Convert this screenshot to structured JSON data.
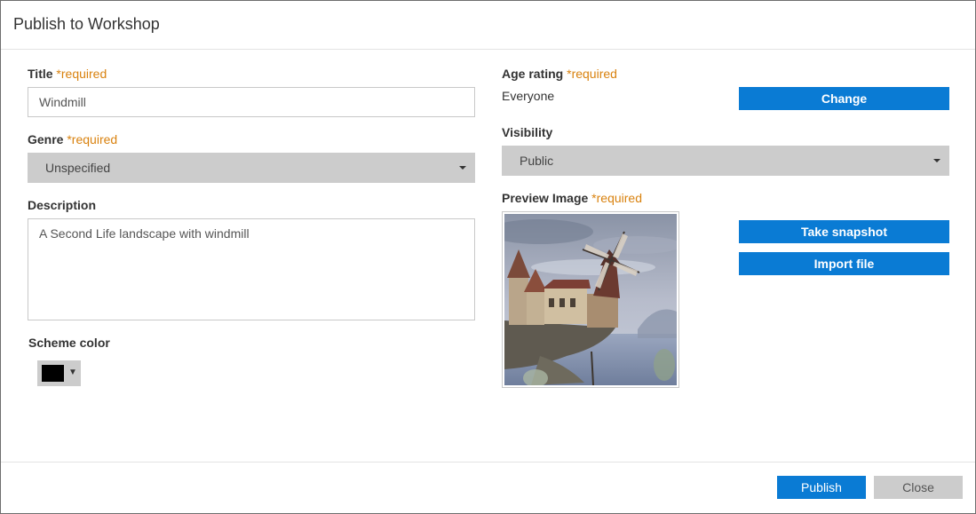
{
  "dialog": {
    "title": "Publish to Workshop"
  },
  "fields": {
    "title": {
      "label": "Title",
      "required": "*required",
      "value": "Windmill"
    },
    "genre": {
      "label": "Genre",
      "required": "*required",
      "selected": "Unspecified"
    },
    "description": {
      "label": "Description",
      "value": "A Second Life landscape with windmill"
    },
    "scheme_color": {
      "label": "Scheme color",
      "color": "#000000"
    },
    "age_rating": {
      "label": "Age rating",
      "required": "*required",
      "value": "Everyone",
      "change_label": "Change"
    },
    "visibility": {
      "label": "Visibility",
      "selected": "Public"
    },
    "preview_image": {
      "label": "Preview Image",
      "required": "*required",
      "take_snapshot_label": "Take snapshot",
      "import_file_label": "Import file"
    }
  },
  "footer": {
    "publish_label": "Publish",
    "close_label": "Close"
  },
  "colors": {
    "accent": "#0a7bd4",
    "required": "#d9820f",
    "select_bg": "#cccccc"
  },
  "icons": {
    "dropdown": "caret-down-icon",
    "color_picker": "triangle-down-icon"
  }
}
